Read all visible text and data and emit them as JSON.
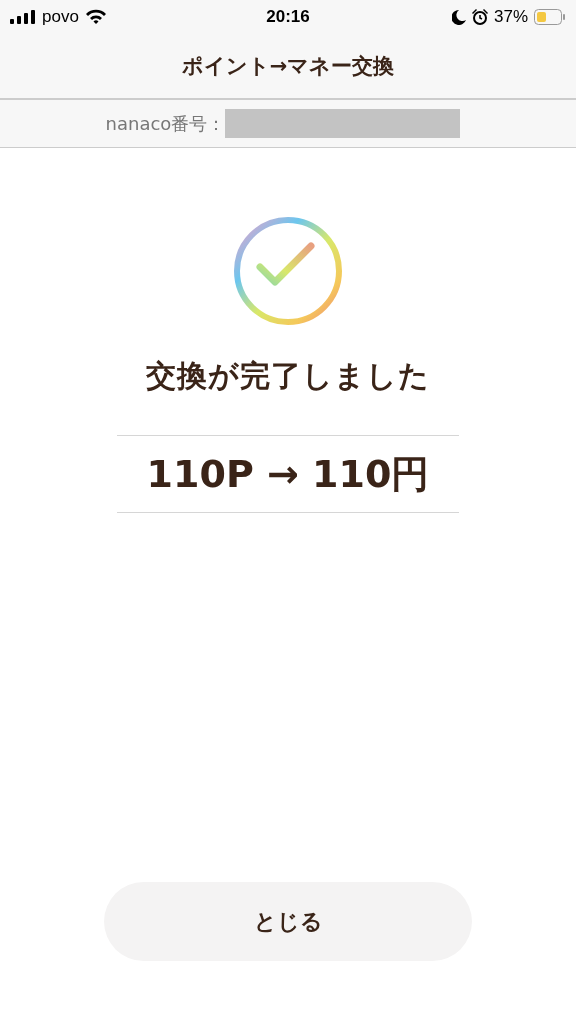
{
  "status_bar": {
    "carrier": "povo",
    "time": "20:16",
    "battery": "37%"
  },
  "header": {
    "title": "ポイント→マネー交換"
  },
  "card_info": {
    "label": "nanaco番号："
  },
  "result": {
    "message": "交換が完了しました",
    "exchange": "110P → 110円"
  },
  "close_button": {
    "label": "とじる"
  }
}
